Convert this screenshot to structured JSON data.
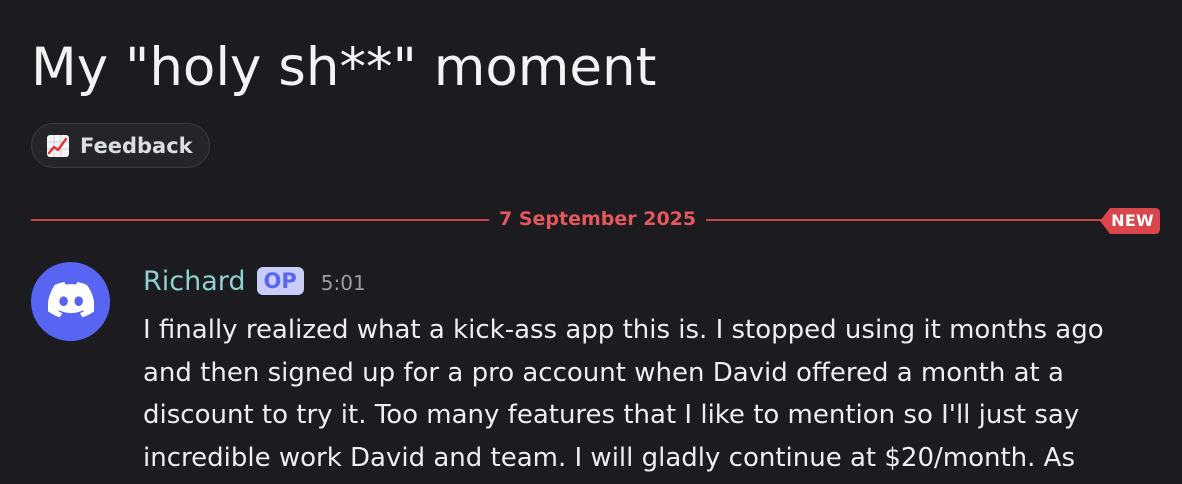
{
  "thread": {
    "title": "My \"holy sh**\" moment",
    "tag": {
      "label": "Feedback",
      "icon": "chart-increasing-icon"
    }
  },
  "divider": {
    "date": "7 September 2025",
    "new_badge": "NEW"
  },
  "message": {
    "avatar_icon": "discord-logo-icon",
    "author": "Richard",
    "author_badge": "OP",
    "time": "5:01",
    "lines": [
      "I finally realized what a kick-ass app this is. I stopped using it months ago",
      "and then signed up for a pro account when David offered a month at a",
      "discount to try it. Too many features that I like to mention so I'll just say",
      "incredible work David and team. I will gladly continue at $20/month. As"
    ]
  },
  "colors": {
    "background": "#1b1b20",
    "accent_red": "#e4585c",
    "author": "#8fd2d1",
    "blurple": "#5865f2"
  }
}
